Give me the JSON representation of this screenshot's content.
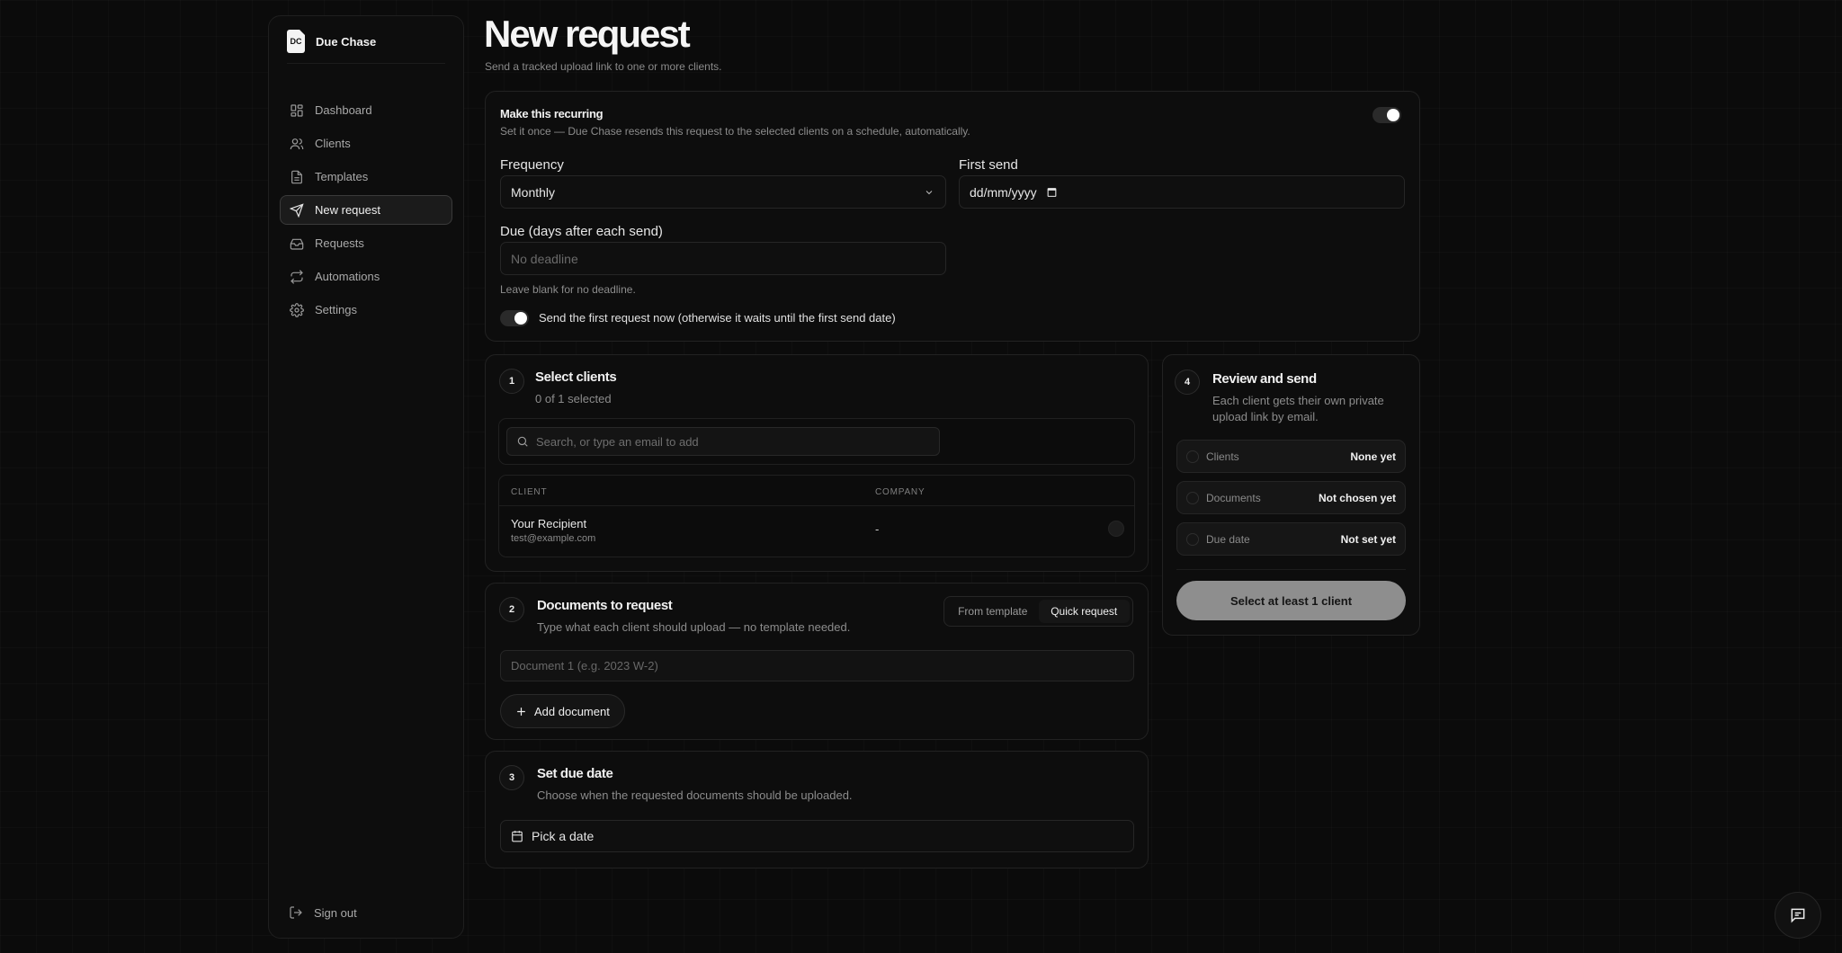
{
  "app": {
    "name": "Due Chase",
    "logo_text": "DC"
  },
  "sidebar": {
    "items": [
      {
        "label": "Dashboard",
        "icon": "dashboard-icon"
      },
      {
        "label": "Clients",
        "icon": "users-icon"
      },
      {
        "label": "Templates",
        "icon": "file-icon"
      },
      {
        "label": "New request",
        "icon": "send-icon",
        "active": true
      },
      {
        "label": "Requests",
        "icon": "inbox-icon"
      },
      {
        "label": "Automations",
        "icon": "repeat-icon"
      },
      {
        "label": "Settings",
        "icon": "gear-icon"
      }
    ],
    "signout": "Sign out"
  },
  "header": {
    "title": "New request",
    "subtitle": "Send a tracked upload link to one or more clients."
  },
  "recurring": {
    "title": "Make this recurring",
    "description": "Set it once — Due Chase resends this request to the selected clients on a schedule, automatically.",
    "enabled": true,
    "frequency_label": "Frequency",
    "frequency_value": "Monthly",
    "first_send_label": "First send",
    "first_send_value": "dd/mm/yyyy",
    "due_label": "Due (days after each send)",
    "due_placeholder": "No deadline",
    "due_hint": "Leave blank for no deadline.",
    "send_now_label": "Send the first request now (otherwise it waits until the first send date)",
    "send_now_enabled": true
  },
  "step1": {
    "number": "1",
    "title": "Select clients",
    "subtitle": "0 of 1 selected",
    "search_placeholder": "Search, or type an email to add",
    "columns": [
      "CLIENT",
      "COMPANY"
    ],
    "rows": [
      {
        "name": "Your Recipient",
        "email": "test@example.com",
        "company": "-"
      }
    ]
  },
  "step2": {
    "number": "2",
    "title": "Documents to request",
    "subtitle": "Type what each client should upload — no template needed.",
    "tabs": [
      "From template",
      "Quick request"
    ],
    "active_tab": "Quick request",
    "doc_placeholder": "Document 1 (e.g. 2023 W-2)",
    "add_label": "Add document"
  },
  "step3": {
    "number": "3",
    "title": "Set due date",
    "subtitle": "Choose when the requested documents should be uploaded.",
    "date_label": "Pick a date"
  },
  "step4": {
    "number": "4",
    "title": "Review and send",
    "subtitle": "Each client gets their own private upload link by email.",
    "rows": [
      {
        "label": "Clients",
        "value": "None yet"
      },
      {
        "label": "Documents",
        "value": "Not chosen yet"
      },
      {
        "label": "Due date",
        "value": "Not set yet"
      }
    ],
    "send_label": "Select at least 1 client"
  },
  "colors": {
    "background": "#0b0b0b",
    "card": "#0d0d0d",
    "button_disabled": "#8e8e8e"
  }
}
